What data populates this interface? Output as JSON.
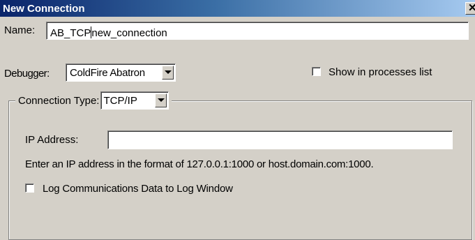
{
  "window": {
    "title": "New Connection",
    "close_glyph": "✕"
  },
  "name": {
    "label": "Name:",
    "value_before_caret": "AB_TCP",
    "value_after_caret": "new_connection"
  },
  "debugger": {
    "label": "Debugger:",
    "selected": "ColdFire Abatron"
  },
  "show_in_processes": {
    "label": "Show in processes list",
    "checked": false
  },
  "connection_type": {
    "label": "Connection Type:",
    "selected": "TCP/IP"
  },
  "ip_address": {
    "label": "IP Address:",
    "value": ""
  },
  "hint": "Enter an IP address in the format of 127.0.0.1:1000 or host.domain.com:1000.",
  "log_comm": {
    "label": "Log Communications Data to Log Window",
    "checked": false
  },
  "colors": {
    "titlebar_start": "#0a246a",
    "titlebar_end": "#a6caf0",
    "dialog_bg": "#d4d0c8"
  }
}
